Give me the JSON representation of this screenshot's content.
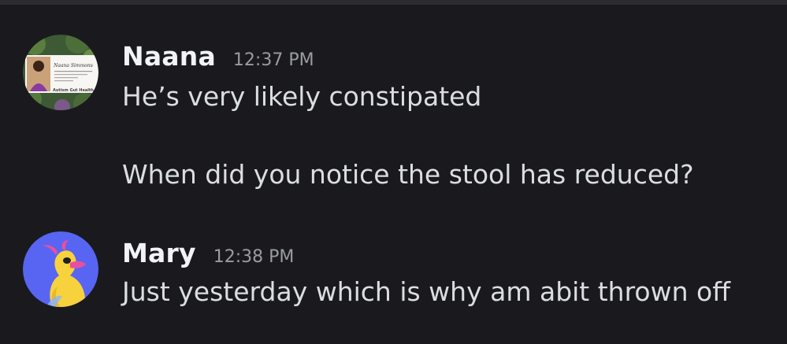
{
  "messages": [
    {
      "username": "Naana",
      "timestamp": "12:37 PM",
      "lines": [
        "He’s very likely constipated",
        "When did you notice the stool has reduced?"
      ],
      "avatar": {
        "icon": "profile-photo-card",
        "card_name": "Naana Simmons",
        "card_footer": "Autism Gut Health"
      }
    },
    {
      "username": "Mary",
      "timestamp": "12:38 PM",
      "lines": [
        "Just yesterday which is why am abit thrown off"
      ],
      "avatar": {
        "icon": "yellow-duck-icon",
        "background_color": "#5865f2"
      }
    }
  ]
}
